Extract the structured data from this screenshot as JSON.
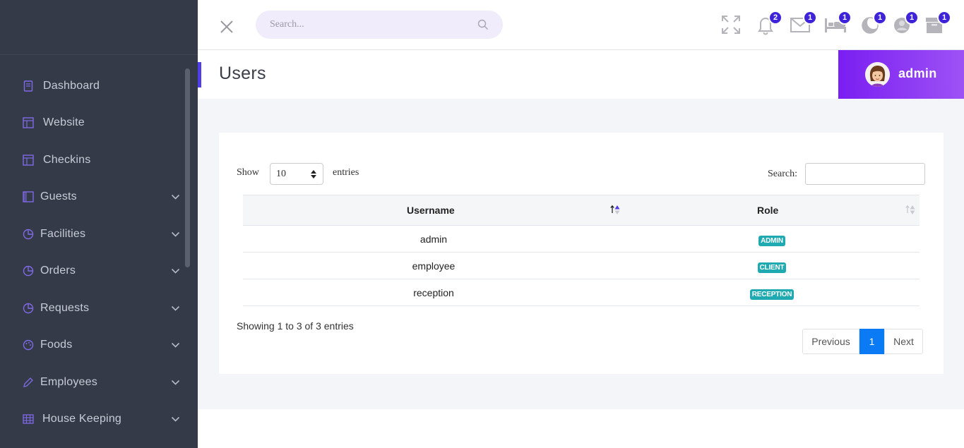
{
  "sidebar": {
    "items": [
      {
        "label": "Dashboard",
        "icon": "book-icon"
      },
      {
        "label": "Website",
        "icon": "layout-icon"
      },
      {
        "label": "Checkins",
        "icon": "layout-icon"
      },
      {
        "label": "Guests",
        "icon": "columns-icon"
      },
      {
        "label": "Facilities",
        "icon": "pie-chart-icon"
      },
      {
        "label": "Orders",
        "icon": "pie-chart-icon"
      },
      {
        "label": "Requests",
        "icon": "pie-chart-icon"
      },
      {
        "label": "Foods",
        "icon": "palette-icon"
      },
      {
        "label": "Employees",
        "icon": "pen-icon"
      },
      {
        "label": "House Keeping",
        "icon": "table-icon"
      }
    ]
  },
  "topbar": {
    "search_placeholder": "Search...",
    "badges": {
      "notifications": "2",
      "messages": "1",
      "bookings": "1",
      "moon": "1",
      "profile": "1",
      "archive": "1"
    }
  },
  "titlebar": {
    "title": "Users",
    "user_name": "admin"
  },
  "table": {
    "show_label": "Show",
    "entries_value": "10",
    "entries_label": "entries",
    "search_label": "Search:",
    "columns": [
      "Username",
      "Role"
    ],
    "rows": [
      {
        "username": "admin",
        "role": "ADMIN"
      },
      {
        "username": "employee",
        "role": "CLIENT"
      },
      {
        "username": "reception",
        "role": "RECEPTION"
      }
    ],
    "info": "Showing 1 to 3 of 3 entries",
    "pagination": {
      "previous": "Previous",
      "current": "1",
      "next": "Next"
    }
  },
  "colors": {
    "sidebar_bg": "#343a48",
    "accent": "#4f3de9",
    "badge": "#3e23d9",
    "user_gradient_start": "#7a1ef2",
    "user_gradient_end": "#9d52f5",
    "role_badge": "#1eaab0",
    "page_active": "#0a7bf5"
  }
}
